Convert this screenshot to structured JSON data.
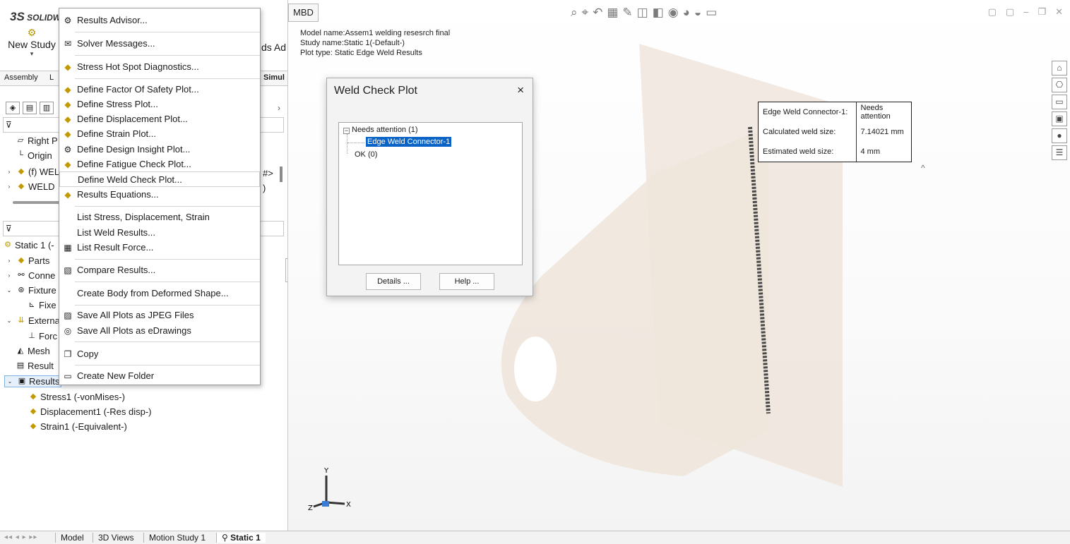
{
  "app": {
    "logo_prefix": "3S",
    "logo_text": "SOLIDW"
  },
  "toolbar": {
    "new_study_label": "New Study",
    "right_fragment": "ds Ad",
    "dropdown_caret": "▾"
  },
  "feature_tabs": [
    "Assembly",
    "L",
    "Simul"
  ],
  "viewport": {
    "mbd_tab": "MBD",
    "model_name": "Model name:Assem1 welding resesrch final",
    "study_name": "Study name:Static 1(-Default-)",
    "plot_type": "Plot type: Static Edge Weld Results"
  },
  "callout": {
    "rows": [
      {
        "key": "Edge Weld Connector-1:",
        "value": "Needs attention"
      },
      {
        "key": "Calculated weld size:",
        "value": "7.14021 mm"
      },
      {
        "key": "Estimated weld size:",
        "value": "4 mm"
      }
    ],
    "caret": "^"
  },
  "dialog": {
    "title": "Weld Check Plot",
    "close": "×",
    "tree": {
      "group1": "Needs attention (1)",
      "group1_child": "Edge Weld Connector-1",
      "group2": "OK (0)"
    },
    "details_button": "Details ...",
    "help_button": "Help ..."
  },
  "left_tree": {
    "upper": [
      {
        "icon": "plane-icon",
        "label": "Right P"
      },
      {
        "icon": "origin-icon",
        "label": "Origin"
      },
      {
        "icon": "weld-icon",
        "label": "(f) WEL"
      },
      {
        "icon": "weld-icon",
        "label": "WELD"
      }
    ],
    "upper_right_fragments": [
      "#>",
      ")"
    ],
    "study": [
      {
        "label": "Static 1 (-"
      },
      {
        "label": "Parts"
      },
      {
        "label": "Conne"
      },
      {
        "label": "Fixture"
      },
      {
        "label": "Fixe"
      },
      {
        "label": "Externa"
      },
      {
        "label": "Forc"
      },
      {
        "label": "Mesh"
      },
      {
        "label": "Result"
      },
      {
        "label": "Results"
      },
      {
        "label": "Stress1 (-vonMises-)"
      },
      {
        "label": "Displacement1 (-Res disp-)"
      },
      {
        "label": "Strain1 (-Equivalent-)"
      }
    ]
  },
  "context_menu": {
    "items": [
      {
        "label": "Results Advisor...",
        "icon": "advisor-icon"
      },
      {
        "label": "Solver Messages...",
        "icon": "messages-icon"
      },
      {
        "label": "Stress Hot Spot Diagnostics...",
        "icon": "hotspot-icon"
      },
      {
        "label": "Define Factor Of Safety Plot...",
        "icon": "fos-plot-icon"
      },
      {
        "label": "Define Stress Plot...",
        "icon": "stress-plot-icon"
      },
      {
        "label": "Define Displacement Plot...",
        "icon": "displacement-plot-icon"
      },
      {
        "label": "Define Strain Plot...",
        "icon": "strain-plot-icon"
      },
      {
        "label": "Define Design Insight Plot...",
        "icon": "design-insight-icon"
      },
      {
        "label": "Define Fatigue Check Plot...",
        "icon": "fatigue-icon"
      },
      {
        "label": "Define Weld Check Plot...",
        "icon": ""
      },
      {
        "label": "Results Equations...",
        "icon": "equations-icon"
      },
      {
        "label": "List Stress, Displacement, Strain",
        "icon": ""
      },
      {
        "label": "List Weld Results...",
        "icon": ""
      },
      {
        "label": "List Result Force...",
        "icon": "result-force-icon"
      },
      {
        "label": "Compare Results...",
        "icon": "compare-icon"
      },
      {
        "label": "Create Body from Deformed Shape...",
        "icon": ""
      },
      {
        "label": "Save All Plots as JPEG Files",
        "icon": "jpeg-icon"
      },
      {
        "label": "Save All Plots as eDrawings",
        "icon": "edrawings-icon"
      },
      {
        "label": "Copy",
        "icon": "copy-icon"
      },
      {
        "label": "Create New Folder",
        "icon": "folder-icon"
      }
    ]
  },
  "triad": {
    "y": "Y",
    "z": "Z",
    "x": "X"
  },
  "bottom_tabs": {
    "nav": "◂◂ ◂ ▸ ▸▸",
    "tabs": [
      "Model",
      "3D Views",
      "Motion Study 1",
      "Static 1"
    ],
    "static_prefix": "⚲"
  },
  "colors": {
    "selection": "#0a64c8",
    "part": "#efe4d6",
    "weld": "#555555"
  }
}
